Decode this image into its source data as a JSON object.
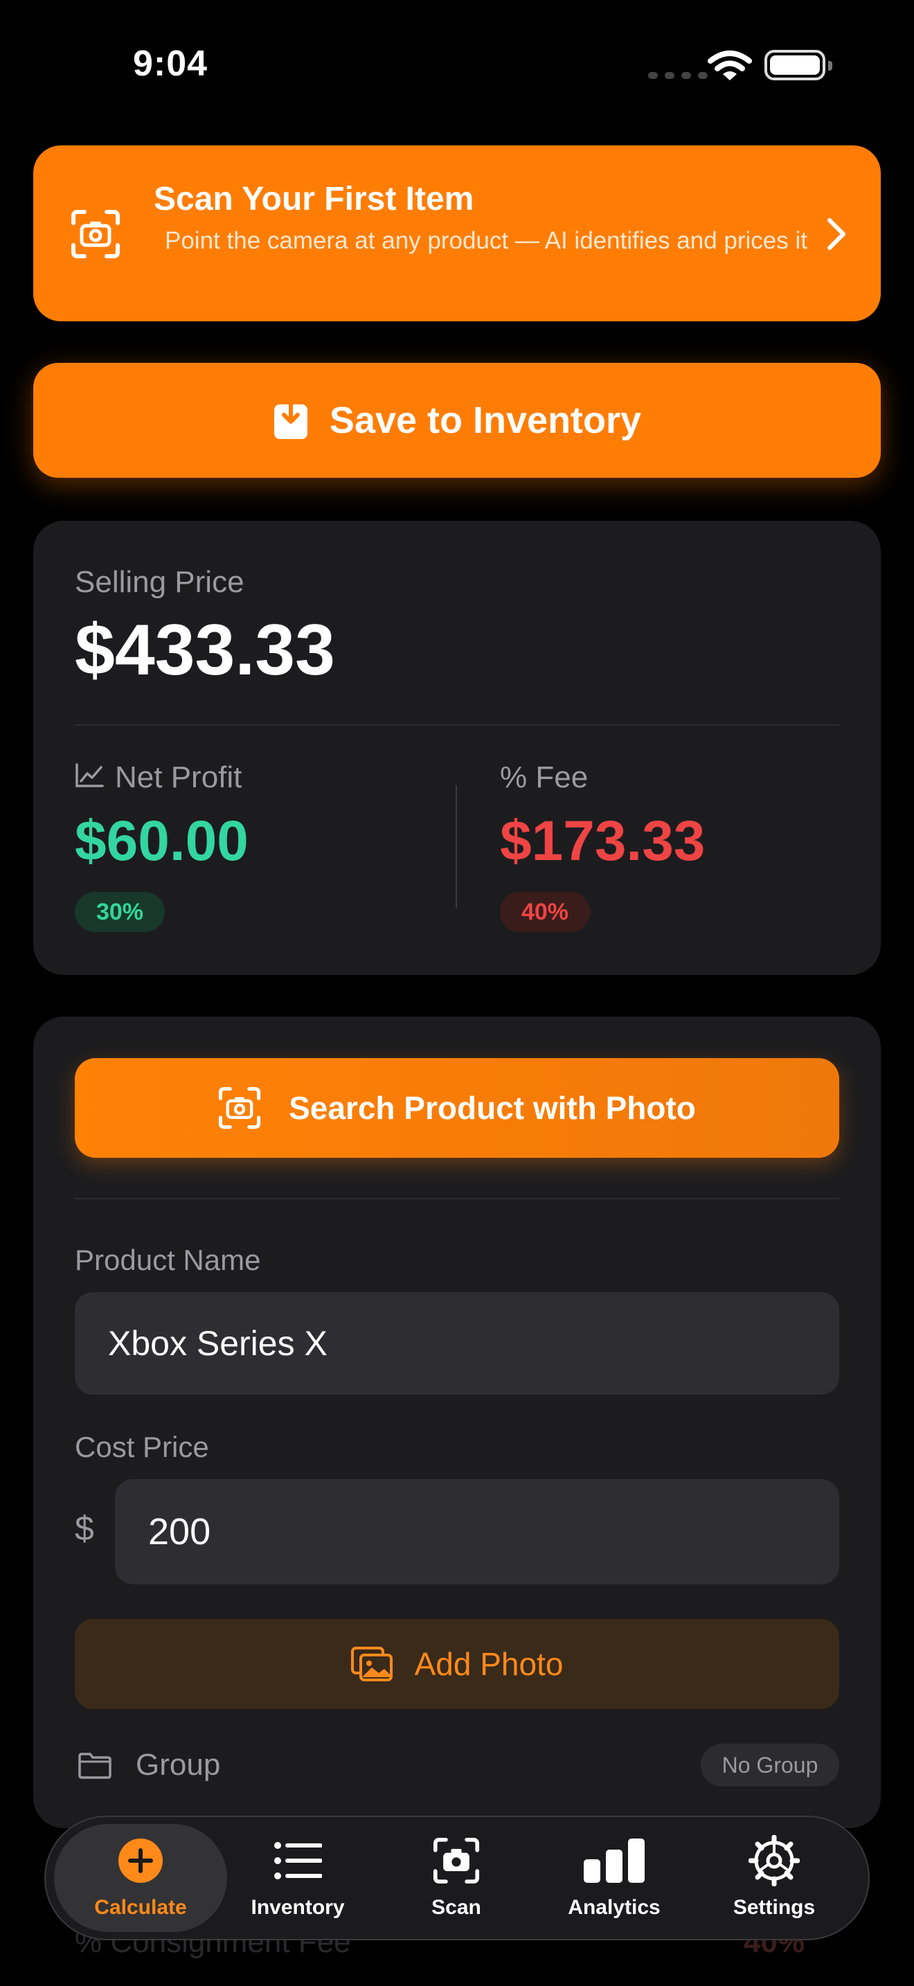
{
  "status_bar": {
    "time": "9:04"
  },
  "promo": {
    "title": "Scan Your First Item",
    "subtitle": "Point the camera at any product — AI identifies and prices it"
  },
  "save_button": {
    "label": "Save to Inventory"
  },
  "summary": {
    "selling_price_label": "Selling Price",
    "selling_price": "$433.33",
    "net_profit_label": "Net Profit",
    "net_profit": "$60.00",
    "net_profit_percent": "30%",
    "fee_label": "% Fee",
    "fee": "$173.33",
    "fee_percent": "40%"
  },
  "form": {
    "search_photo_label": "Search Product with Photo",
    "product_name_label": "Product Name",
    "product_name_value": "Xbox Series X",
    "cost_price_label": "Cost Price",
    "currency_symbol": "$",
    "cost_price_value": "200",
    "add_photo_label": "Add Photo",
    "group_label": "Group",
    "group_value": "No Group",
    "consignment_label": "% Consignment Fee",
    "consignment_value": "40%"
  },
  "tabs": [
    {
      "label": "Calculate",
      "icon": "plus-circle-icon",
      "active": true
    },
    {
      "label": "Inventory",
      "icon": "list-icon",
      "active": false
    },
    {
      "label": "Scan",
      "icon": "scan-camera-icon",
      "active": false
    },
    {
      "label": "Analytics",
      "icon": "bar-chart-icon",
      "active": false
    },
    {
      "label": "Settings",
      "icon": "gear-icon",
      "active": false
    }
  ],
  "colors": {
    "accent": "#ff7d05",
    "profit": "#33d69f",
    "fee": "#ef4444",
    "background": "#000000",
    "card": "#1c1c1e"
  }
}
